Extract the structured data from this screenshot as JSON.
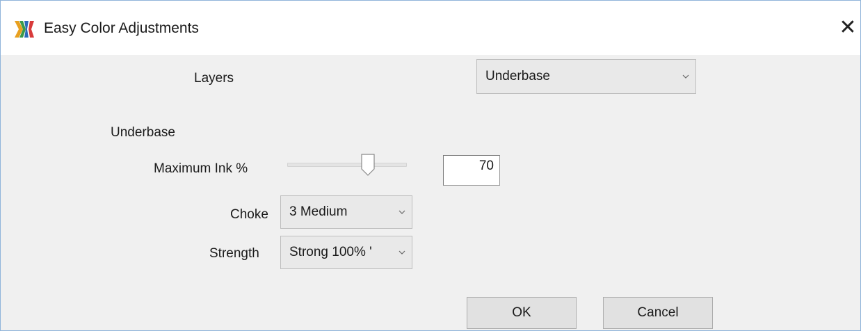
{
  "window": {
    "title": "Easy Color Adjustments",
    "close_glyph": "✕",
    "icons": {
      "app": "app-logo-icon",
      "close": "close-icon"
    }
  },
  "layers": {
    "label": "Layers",
    "selected": "Underbase"
  },
  "underbase_section": {
    "heading": "Underbase",
    "max_ink": {
      "label": "Maximum Ink %",
      "value": "70",
      "slider_fraction": 0.7
    },
    "choke": {
      "label": "Choke",
      "selected": "3 Medium"
    },
    "strength": {
      "label": "Strength",
      "selected": "Strong 100% '"
    }
  },
  "buttons": {
    "ok": "OK",
    "cancel": "Cancel"
  },
  "colors": {
    "dialog_bg": "#f0f0f0",
    "titlebar_bg": "#ffffff",
    "border_accent": "#8fb4da"
  }
}
